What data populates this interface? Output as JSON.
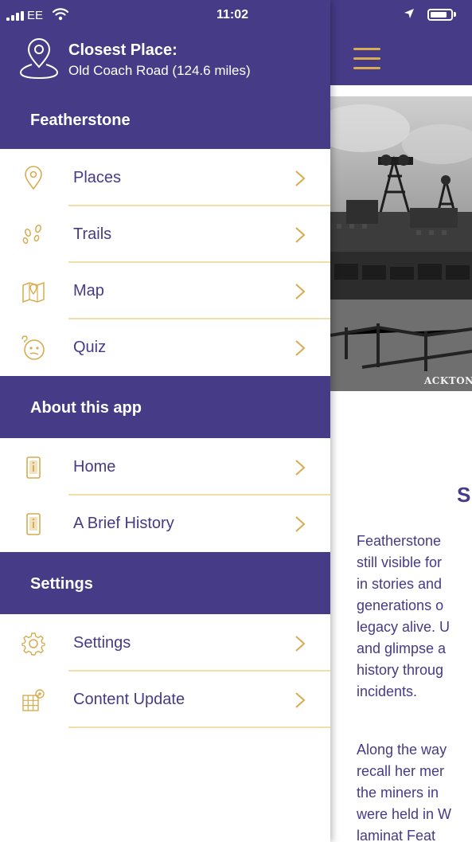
{
  "status_bar": {
    "carrier": "EE",
    "time": "11:02"
  },
  "closest_place": {
    "title": "Closest Place:",
    "subtitle": "Old Coach Road (124.6 miles)"
  },
  "sections": [
    {
      "label": "Featherstone",
      "items": [
        {
          "label": "Places",
          "icon": "location-pin-icon"
        },
        {
          "label": "Trails",
          "icon": "footprints-icon"
        },
        {
          "label": "Map",
          "icon": "map-icon"
        },
        {
          "label": "Quiz",
          "icon": "thinking-face-icon"
        }
      ]
    },
    {
      "label": "About this app",
      "items": [
        {
          "label": "Home",
          "icon": "info-phone-icon"
        },
        {
          "label": "A Brief History",
          "icon": "info-phone-icon"
        }
      ]
    },
    {
      "label": "Settings",
      "items": [
        {
          "label": "Settings",
          "icon": "gear-icon"
        },
        {
          "label": "Content Update",
          "icon": "content-update-icon"
        }
      ]
    }
  ],
  "main": {
    "hero_caption": "ACKTON H",
    "heading": "S",
    "paragraph1_lines": [
      "Featherstone",
      "still visible for",
      "in stories and",
      "generations o",
      "legacy alive. U",
      "and glimpse a",
      "history throug",
      "incidents."
    ],
    "paragraph2_lines": [
      "Along the way",
      "recall her mer",
      "the miners in",
      "were held in W",
      "laminat Feat"
    ]
  },
  "colors": {
    "brand_purple": "#463b86",
    "accent_gold": "#d8ac4f",
    "divider": "#f0dfa6"
  }
}
